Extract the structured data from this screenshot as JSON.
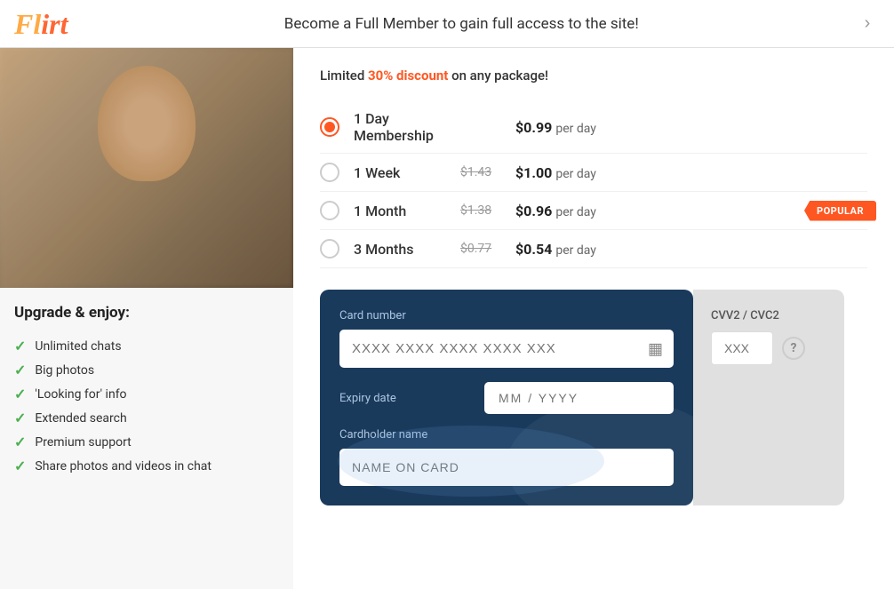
{
  "header": {
    "logo": "Flirt",
    "title": "Become a Full Member to gain full access to the site!",
    "close_label": "›"
  },
  "discount": {
    "text_before": "Limited ",
    "percent": "30% discount",
    "text_after": " on any package!"
  },
  "membership_plans": [
    {
      "id": "1day",
      "label": "1 Day Membership",
      "original_price": null,
      "current_price": "$0.99",
      "per_day": "per day",
      "selected": true,
      "popular": false
    },
    {
      "id": "1week",
      "label": "1 Week",
      "original_price": "$1.43",
      "current_price": "$1.00",
      "per_day": "per day",
      "selected": false,
      "popular": false
    },
    {
      "id": "1month",
      "label": "1 Month",
      "original_price": "$1.38",
      "current_price": "$0.96",
      "per_day": "per day",
      "selected": false,
      "popular": true,
      "popular_label": "POPULAR"
    },
    {
      "id": "3months",
      "label": "3 Months",
      "original_price": "$0.77",
      "current_price": "$0.54",
      "per_day": "per day",
      "selected": false,
      "popular": false
    }
  ],
  "features": {
    "title": "Upgrade & enjoy:",
    "items": [
      "Unlimited chats",
      "Big photos",
      "'Looking for' info",
      "Extended search",
      "Premium support",
      "Share photos and videos in chat"
    ]
  },
  "card_form": {
    "card_number_label": "Card number",
    "card_number_placeholder": "XXXX XXXX XXXX XXXX XXX",
    "expiry_label": "Expiry date",
    "expiry_placeholder": "MM / YYYY",
    "cardholder_label": "Cardholder name",
    "cardholder_placeholder": "NAME ON CARD",
    "cvv_label": "CVV2 / CVC2",
    "cvv_placeholder": "XXX"
  },
  "icons": {
    "check": "✓",
    "card_icon": "▦",
    "question": "?"
  }
}
